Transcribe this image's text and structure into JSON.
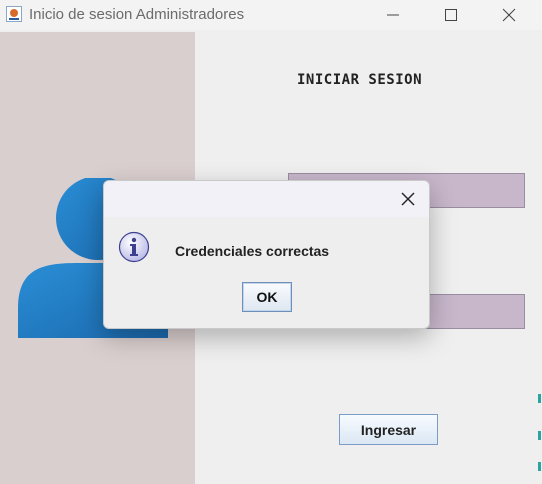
{
  "window": {
    "title": "Inicio de sesion Administradores",
    "icon": "java-cup-icon",
    "controls": [
      "minimize-icon",
      "maximize-icon",
      "close-icon"
    ]
  },
  "form": {
    "heading": "INICIAR SESION",
    "username_value": "",
    "password_value": "",
    "submit_label": "Ingresar"
  },
  "dialog": {
    "icon": "info-icon",
    "message": "Credenciales correctas",
    "ok_label": "OK"
  },
  "colors": {
    "left_panel": "#dacfcf",
    "field_background": "#c8b6cb",
    "user_icon_blue": "#1f7fc6"
  }
}
